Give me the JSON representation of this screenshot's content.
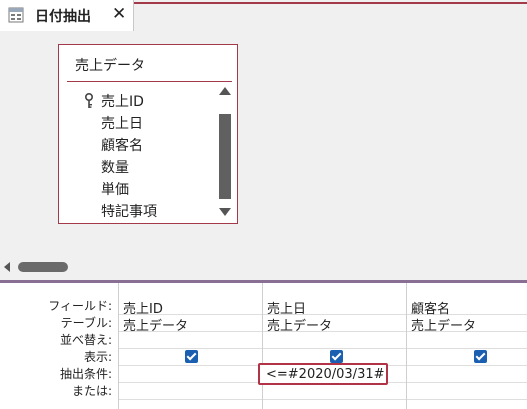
{
  "tab": {
    "title": "日付抽出",
    "close": "✕",
    "icon": "query-icon"
  },
  "table_box": {
    "title": "売上データ",
    "fields": [
      "売上ID",
      "売上日",
      "顧客名",
      "数量",
      "単価",
      "特記事項"
    ],
    "key_field_index": 0
  },
  "grid": {
    "row_labels": [
      "フィールド:",
      "テーブル:",
      "並べ替え:",
      "表示:",
      "抽出条件:",
      "または:"
    ],
    "columns": [
      {
        "field": "売上ID",
        "table": "売上データ",
        "show": true,
        "criteria": ""
      },
      {
        "field": "売上日",
        "table": "売上データ",
        "show": true,
        "criteria": "<=#2020/03/31#"
      },
      {
        "field": "顧客名",
        "table": "売上データ",
        "show": true,
        "criteria": ""
      }
    ]
  },
  "colors": {
    "accent": "#a33a4a",
    "checkbox": "#1b5fb0",
    "splitter": "#8a6f94"
  }
}
